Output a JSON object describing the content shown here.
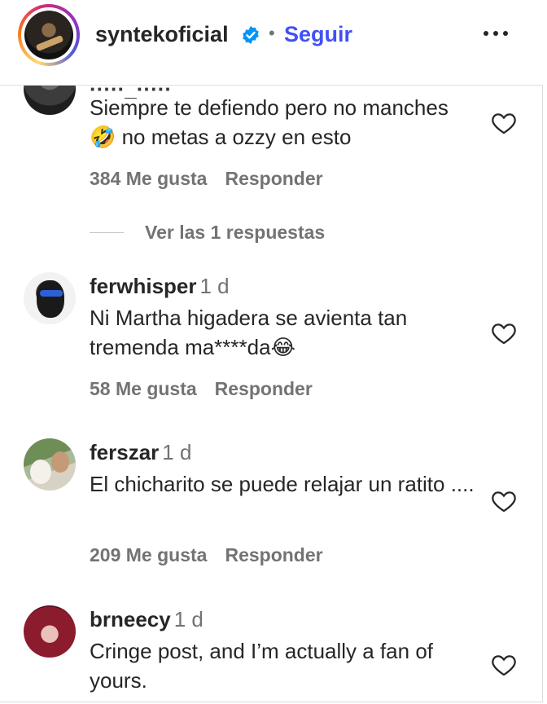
{
  "header": {
    "username": "syntekoficial",
    "separator": "•",
    "follow_label": "Seguir"
  },
  "comments": [
    {
      "author": "",
      "time": "",
      "text": "Siempre te defiendo pero no manches 🤣 no metas a ozzy en esto",
      "likes": "384 Me gusta",
      "reply_label": "Responder",
      "replies_label": "Ver las 1 respuestas"
    },
    {
      "author": "ferwhisper",
      "time": "1 d",
      "text": "Ni Martha higadera se avienta tan tremenda ma****da😂",
      "likes": "58 Me gusta",
      "reply_label": "Responder"
    },
    {
      "author": "ferszar",
      "time": "1 d",
      "text": "El chicharito se puede relajar un ratito ....",
      "likes": "209 Me gusta",
      "reply_label": "Responder"
    },
    {
      "author": "brneecy",
      "time": "1 d",
      "text": "Cringe post, and I’m actually a fan of yours."
    }
  ],
  "colors": {
    "follow": "#4150f7",
    "verified": "#0095f6",
    "muted": "#737373",
    "text": "#262626"
  },
  "icons": [
    "verified-badge-icon",
    "more-options-icon",
    "heart-icon"
  ]
}
